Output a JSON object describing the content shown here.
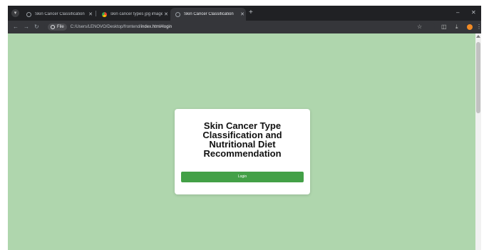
{
  "browser": {
    "tabs": [
      {
        "title": "Skin Cancer Classification",
        "active": false,
        "icon": "globe-icon"
      },
      {
        "title": "skin cancer types jpg images",
        "active": false,
        "icon": "chrome-icon"
      },
      {
        "title": "Skin Cancer Classification",
        "active": true,
        "icon": "globe-icon"
      }
    ],
    "file_chip": "File",
    "url_prefix": "C:/Users/LENOVO/Desktop/frontend/",
    "url_highlight": "index.html#login"
  },
  "page": {
    "title": "Skin Cancer Type Classification and Nutritional Diet Recommendation",
    "login_label": "Login",
    "background_color": "#afd6ad",
    "button_color": "#43a047"
  }
}
